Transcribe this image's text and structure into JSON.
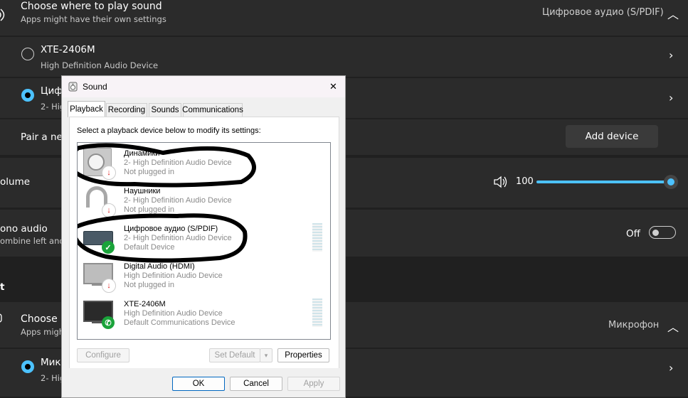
{
  "output": {
    "title": "Choose where to play sound",
    "subtitle": "Apps might have their own settings",
    "selected": "Цифровое аудио (S/PDIF)",
    "devices": [
      {
        "name": "XTE-2406M",
        "desc": "High Definition Audio Device"
      },
      {
        "name": "Циф",
        "desc": "2- Hig"
      }
    ],
    "pair_label": "Pair a new",
    "add_device": "Add device"
  },
  "volume": {
    "label": "olume",
    "value": "100",
    "level": 1.0
  },
  "mono": {
    "label": "ono audio",
    "desc": "ombine left and a",
    "state": "Off"
  },
  "input": {
    "section": "t",
    "title": "Choose a",
    "subtitle": "Apps might",
    "selected": "Микрофон",
    "device_name": "Мик",
    "device_desc": "2- Hig"
  },
  "dialog": {
    "title": "Sound",
    "close": "✕",
    "tabs": [
      "Playback",
      "Recording",
      "Sounds",
      "Communications"
    ],
    "instruction": "Select a playback device below to modify its settings:",
    "devices": [
      {
        "name": "Динамики",
        "desc": "2- High Definition Audio Device",
        "status": "Not plugged in"
      },
      {
        "name": "Наушники",
        "desc": "2- High Definition Audio Device",
        "status": "Not plugged in"
      },
      {
        "name": "Цифровое аудио (S/PDIF)",
        "desc": "2- High Definition Audio Device",
        "status": "Default Device"
      },
      {
        "name": "Digital Audio (HDMI)",
        "desc": "High Definition Audio Device",
        "status": "Not plugged in"
      },
      {
        "name": "XTE-2406M",
        "desc": "High Definition Audio Device",
        "status": "Default Communications Device"
      }
    ],
    "configure": "Configure",
    "set_default": "Set Default",
    "properties": "Properties",
    "ok": "OK",
    "cancel": "Cancel",
    "apply": "Apply"
  }
}
